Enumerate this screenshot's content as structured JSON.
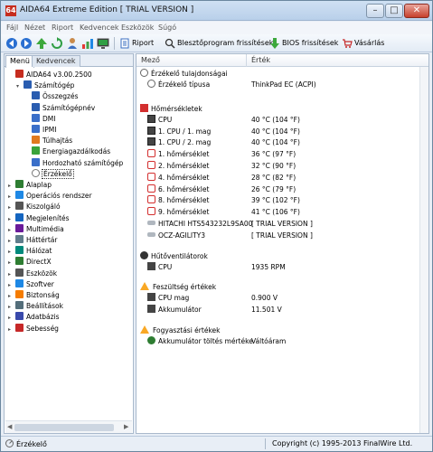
{
  "window": {
    "icon_text": "64",
    "title": "AIDA64 Extreme Edition  [ TRIAL VERSION ]",
    "min": "–",
    "max": "□",
    "close": "✕"
  },
  "menu": [
    "Fájl",
    "Nézet",
    "Riport",
    "Kedvencek",
    "Eszközök",
    "Súgó"
  ],
  "toolbar": {
    "report_label": "Riport",
    "bios_update_label": "Blesztőprogram frissítések",
    "bios_label": "BIOS frissítések",
    "buy_label": "Vásárlás"
  },
  "left_tabs": [
    "Menü",
    "Kedvencek"
  ],
  "tree": [
    {
      "label": "AIDA64 v3.00.2500",
      "icon": "aida64-icon",
      "color": "#c62d1f"
    },
    {
      "label": "Számítógép",
      "icon": "computer-icon",
      "color": "#2a5db0"
    },
    {
      "label": "Összegzés",
      "icon": "summary-icon",
      "color": "#2a5db0"
    },
    {
      "label": "Számítógépnév",
      "icon": "computer-name-icon",
      "color": "#2a5db0"
    },
    {
      "label": "DMI",
      "icon": "dmi-icon",
      "color": "#3a6fc9"
    },
    {
      "label": "IPMI",
      "icon": "ipmi-icon",
      "color": "#3a6fc9"
    },
    {
      "label": "Túlhajtás",
      "icon": "overclock-icon",
      "color": "#e07a1f"
    },
    {
      "label": "Energiagazdálkodás",
      "icon": "power-icon",
      "color": "#3aa33a"
    },
    {
      "label": "Hordozható számítógép",
      "icon": "portable-icon",
      "color": "#3a6fc9"
    },
    {
      "label": "Érzékelő",
      "icon": "sensor-icon",
      "color": "#777777"
    },
    {
      "label": "Alaplap",
      "icon": "motherboard-icon",
      "color": "#2e7d32"
    },
    {
      "label": "Operációs rendszer",
      "icon": "os-icon",
      "color": "#1e88e5"
    },
    {
      "label": "Kiszolgáló",
      "icon": "server-icon",
      "color": "#555555"
    },
    {
      "label": "Megjelenítés",
      "icon": "display-icon",
      "color": "#1565c0"
    },
    {
      "label": "Multimédia",
      "icon": "multimedia-icon",
      "color": "#6a1b9a"
    },
    {
      "label": "Háttértár",
      "icon": "storage-icon",
      "color": "#607d8b"
    },
    {
      "label": "Hálózat",
      "icon": "network-icon",
      "color": "#00897b"
    },
    {
      "label": "DirectX",
      "icon": "directx-icon",
      "color": "#2e7d32"
    },
    {
      "label": "Eszközök",
      "icon": "devices-icon",
      "color": "#555555"
    },
    {
      "label": "Szoftver",
      "icon": "software-icon",
      "color": "#1e88e5"
    },
    {
      "label": "Biztonság",
      "icon": "security-icon",
      "color": "#f57c00"
    },
    {
      "label": "Beállítások",
      "icon": "settings-icon",
      "color": "#546e7a"
    },
    {
      "label": "Adatbázis",
      "icon": "database-icon",
      "color": "#3949ab"
    },
    {
      "label": "Sebesség",
      "icon": "benchmark-icon",
      "color": "#c62828"
    }
  ],
  "columns": {
    "field": "Mező",
    "value": "Érték"
  },
  "sections": {
    "sensor_props": "Érzékelő tulajdonságai",
    "temps": "Hőmérsékletek",
    "fans": "Hűtőventilátorok",
    "voltages": "Feszültség értékek",
    "power": "Fogyasztási értékek"
  },
  "sensor_props": [
    {
      "field": "Érzékelő típusa",
      "value": "ThinkPad EC  (ACPI)"
    }
  ],
  "temps": [
    {
      "field": "CPU",
      "value": "40 °C  (104 °F)",
      "icon": "cpu"
    },
    {
      "field": "1. CPU / 1. mag",
      "value": "40 °C  (104 °F)",
      "icon": "cpu"
    },
    {
      "field": "1. CPU / 2. mag",
      "value": "40 °C  (104 °F)",
      "icon": "cpu"
    },
    {
      "field": "1. hőmérséklet",
      "value": "36 °C  (97 °F)",
      "icon": "temp"
    },
    {
      "field": "2. hőmérséklet",
      "value": "32 °C  (90 °F)",
      "icon": "temp"
    },
    {
      "field": "4. hőmérséklet",
      "value": "28 °C  (82 °F)",
      "icon": "temp"
    },
    {
      "field": "6. hőmérséklet",
      "value": "26 °C  (79 °F)",
      "icon": "temp"
    },
    {
      "field": "8. hőmérséklet",
      "value": "39 °C  (102 °F)",
      "icon": "temp"
    },
    {
      "field": "9. hőmérséklet",
      "value": "41 °C  (106 °F)",
      "icon": "temp"
    },
    {
      "field": "HITACHI HTS543232L9SA00",
      "value": "[ TRIAL VERSION ]",
      "icon": "disk"
    },
    {
      "field": "OCZ-AGILITY3",
      "value": "[ TRIAL VERSION ]",
      "icon": "disk"
    }
  ],
  "fans": [
    {
      "field": "CPU",
      "value": "1935 RPM"
    }
  ],
  "voltages": [
    {
      "field": "CPU mag",
      "value": "0.900 V"
    },
    {
      "field": "Akkumulátor",
      "value": "11.501 V"
    }
  ],
  "power": [
    {
      "field": "Akkumulátor töltés mértéke",
      "value": "Váltóáram"
    }
  ],
  "status": {
    "left": "Érzékelő",
    "right": "Copyright (c) 1995-2013 FinalWire Ltd."
  }
}
